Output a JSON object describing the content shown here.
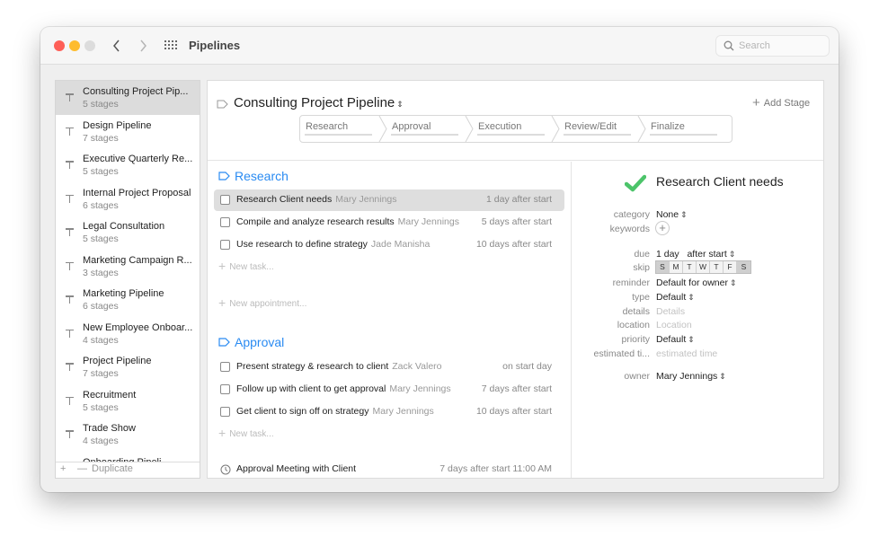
{
  "window": {
    "title": "Pipelines",
    "search_placeholder": "Search"
  },
  "sidebar": {
    "items": [
      {
        "name": "Consulting Project Pip...",
        "stages": "5 stages",
        "selected": true
      },
      {
        "name": "Design Pipeline",
        "stages": "7 stages"
      },
      {
        "name": "Executive Quarterly Re...",
        "stages": "5 stages"
      },
      {
        "name": "Internal Project Proposal",
        "stages": "6 stages"
      },
      {
        "name": "Legal Consultation",
        "stages": "5 stages"
      },
      {
        "name": "Marketing Campaign R...",
        "stages": "3 stages"
      },
      {
        "name": "Marketing Pipeline",
        "stages": "6 stages"
      },
      {
        "name": "New Employee Onboar...",
        "stages": "4 stages"
      },
      {
        "name": "Project Pipeline",
        "stages": "7 stages"
      },
      {
        "name": "Recruitment",
        "stages": "5 stages"
      },
      {
        "name": "Trade Show",
        "stages": "4 stages"
      },
      {
        "name": "Onboarding Pipeli...",
        "stages": ""
      }
    ],
    "footer": {
      "add": "+",
      "remove": "—",
      "duplicate": "Duplicate"
    }
  },
  "pipeline": {
    "title": "Consulting Project Pipeline",
    "add_stage": "Add Stage",
    "stages": [
      "Research",
      "Approval",
      "Execution",
      "Review/Edit",
      "Finalize"
    ]
  },
  "sections": [
    {
      "title": "Research",
      "tasks": [
        {
          "title": "Research Client needs",
          "owner": "Mary Jennings",
          "due": "1 day after start",
          "selected": true
        },
        {
          "title": "Compile and analyze research results",
          "owner": "Mary Jennings",
          "due": "5 days after start"
        },
        {
          "title": "Use research to define strategy",
          "owner": "Jade Manisha",
          "due": "10 days after start"
        }
      ],
      "new_task": "New task...",
      "new_appointment": "New appointment..."
    },
    {
      "title": "Approval",
      "tasks": [
        {
          "title": "Present strategy & research to client",
          "owner": "Zack Valero",
          "due": "on start day"
        },
        {
          "title": "Follow up with client to get approval",
          "owner": "Mary Jennings",
          "due": "7 days after start"
        },
        {
          "title": "Get client to sign off on strategy",
          "owner": "Mary Jennings",
          "due": "10 days after start"
        }
      ],
      "new_task": "New task...",
      "appointments": [
        {
          "title": "Approval Meeting with Client",
          "due": "7 days after start 11:00 AM"
        }
      ]
    }
  ],
  "detail": {
    "title": "Research Client needs",
    "status_color": "#4cc46a",
    "fields": {
      "category": {
        "label": "category",
        "value": "None"
      },
      "keywords": {
        "label": "keywords",
        "value": "+"
      },
      "due": {
        "label": "due",
        "amount": "1 day",
        "relation": "after start"
      },
      "skip": {
        "label": "skip",
        "days": [
          "S",
          "M",
          "T",
          "W",
          "T",
          "F",
          "S"
        ],
        "skipped": [
          true,
          false,
          false,
          false,
          false,
          false,
          true
        ]
      },
      "reminder": {
        "label": "reminder",
        "value": "Default for owner"
      },
      "type": {
        "label": "type",
        "value": "Default"
      },
      "details": {
        "label": "details",
        "placeholder": "Details"
      },
      "location": {
        "label": "location",
        "placeholder": "Location"
      },
      "priority": {
        "label": "priority",
        "value": "Default"
      },
      "estimated_time": {
        "label": "estimated ti...",
        "placeholder": "estimated time"
      },
      "owner": {
        "label": "owner",
        "value": "Mary Jennings"
      }
    }
  },
  "colors": {
    "accent": "#2a8bf2",
    "check": "#4cc46a",
    "close": "#fe5f57",
    "minimize": "#febc2e"
  }
}
